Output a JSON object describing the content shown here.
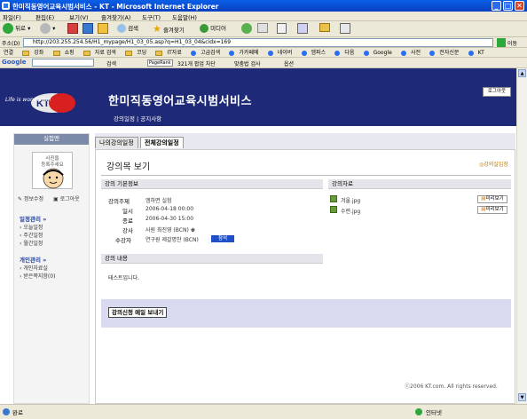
{
  "window": {
    "title": "한미직동영어교육시범서비스 - KT - Microsoft Internet Explorer",
    "min_icon": "minimize-icon",
    "max_icon": "maximize-icon",
    "close_icon": "close-icon"
  },
  "menu": [
    "파일(F)",
    "편집(E)",
    "보기(V)",
    "즐겨찾기(A)",
    "도구(T)",
    "도움말(H)"
  ],
  "toolbar": {
    "back": "뒤로",
    "search": "검색",
    "favorites": "즐겨찾기",
    "media": "미디어"
  },
  "address": {
    "label": "주소(D)",
    "url": "http://203.255.254.56/H1_mypage/H1_03_05.asp?q=H1_03_04&cidx=169",
    "go": "이동"
  },
  "links": {
    "label": "연결",
    "items": [
      "강좌",
      "쇼핑",
      "자료 검색",
      "코딩",
      "IT자료",
      "고급검색",
      "가카페메",
      "네이버",
      "엠파스",
      "다음",
      "Google",
      "사전",
      "전자신문",
      "KT"
    ]
  },
  "google": {
    "label": "Google",
    "search": "검색",
    "blocked": "321개 팝업 차단",
    "spell": "맞춤법 검사",
    "options": "옵션"
  },
  "site": {
    "logo_text": "Life is wonderful!",
    "logo_brand": "KT",
    "title": "한미직동영어교육시범서비스",
    "subnav": "강의일정 | 공지사항",
    "logout": "로그아웃"
  },
  "left": {
    "header": "실험맨",
    "photo_text": "사진을\n등록주세요",
    "info_edit": "정보수정",
    "logout": "로그아웃",
    "schedule_head": "일정관리 »",
    "schedule_items": [
      "오늘일정",
      "주간일정",
      "월간일정"
    ],
    "personal_head": "개인관리 »",
    "personal_items": [
      "개인자료실",
      "받은쪽지함(0)"
    ]
  },
  "tabs": [
    "나의강의일정",
    "전체강의일정"
  ],
  "panel": {
    "title": "강의목 보기",
    "enter_btn": "강의실입장",
    "basic_head": "강의 기본정보",
    "fields": [
      {
        "label": "강의주제",
        "value": "엠하면 실험"
      },
      {
        "label": "일시",
        "value": "2006-04-18 00:00"
      },
      {
        "label": "종료",
        "value": "2006-04-30 15:00"
      },
      {
        "label": "강사",
        "value": "사원 최진영 (BCN)"
      },
      {
        "label": "수강자",
        "value": "연구원 제갈명찬 (BCN)"
      }
    ],
    "student_badge": "참석",
    "materials_head": "강의자료",
    "materials": [
      {
        "name": "겨울.jpg",
        "btn": "미리보기"
      },
      {
        "name": "수련.jpg",
        "btn": "미리보기"
      }
    ],
    "content_head": "강의 내용",
    "content_text": "테스트입니다.",
    "apply_btn": "강의신청 메일 보내기",
    "copyright": "ⓒ2006 KT.com. All rights reserved."
  },
  "status": {
    "left": "완료",
    "zone": "인터넷"
  }
}
